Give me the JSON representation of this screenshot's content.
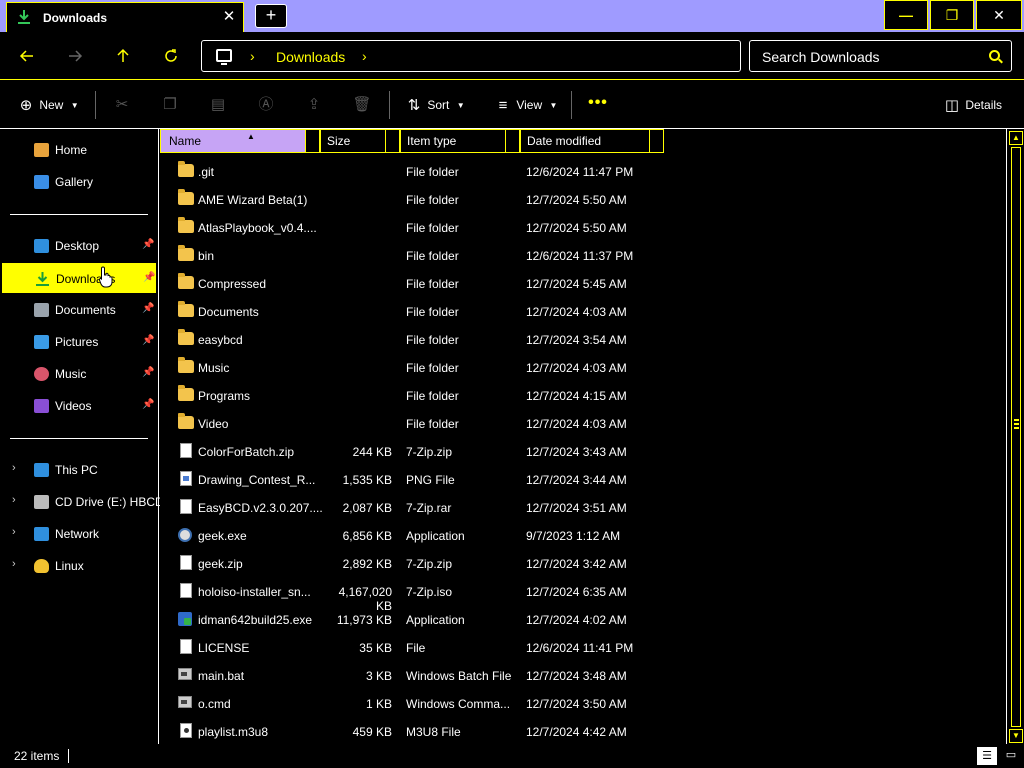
{
  "window": {
    "tab_title": "Downloads",
    "tab_close": "✕",
    "new_tab": "+",
    "minimize": "—",
    "maximize": "❐",
    "close": "✕"
  },
  "address": {
    "crumbs": [
      "Downloads"
    ],
    "search_placeholder": "Search Downloads"
  },
  "toolbar": {
    "new_label": "New",
    "sort_label": "Sort",
    "view_label": "View",
    "details_label": "Details",
    "more_label": "•••"
  },
  "sidebar": {
    "items": [
      {
        "label": "Home",
        "icon": "home-icon"
      },
      {
        "label": "Gallery",
        "icon": "gallery-icon"
      },
      {
        "label": "Desktop",
        "icon": "desktop-icon",
        "pinned": true
      },
      {
        "label": "Downloads",
        "icon": "downloads-icon",
        "pinned": true,
        "selected": true
      },
      {
        "label": "Documents",
        "icon": "documents-icon",
        "pinned": true
      },
      {
        "label": "Pictures",
        "icon": "pictures-icon",
        "pinned": true
      },
      {
        "label": "Music",
        "icon": "music-icon",
        "pinned": true
      },
      {
        "label": "Videos",
        "icon": "videos-icon",
        "pinned": true
      },
      {
        "label": "This PC",
        "icon": "this-pc-icon",
        "expandable": true
      },
      {
        "label": "CD Drive (E:) HBCD",
        "icon": "cd-drive-icon",
        "expandable": true
      },
      {
        "label": "Network",
        "icon": "network-icon",
        "expandable": true
      },
      {
        "label": "Linux",
        "icon": "linux-icon",
        "expandable": true
      }
    ]
  },
  "columns": {
    "name": "Name",
    "size": "Size",
    "type": "Item type",
    "date": "Date modified"
  },
  "files": [
    {
      "name": ".git",
      "size": "",
      "type": "File folder",
      "date": "12/6/2024 11:47 PM",
      "icon": "folder"
    },
    {
      "name": "AME Wizard Beta(1)",
      "size": "",
      "type": "File folder",
      "date": "12/7/2024 5:50 AM",
      "icon": "folder"
    },
    {
      "name": "AtlasPlaybook_v0.4....",
      "size": "",
      "type": "File folder",
      "date": "12/7/2024 5:50 AM",
      "icon": "folder"
    },
    {
      "name": "bin",
      "size": "",
      "type": "File folder",
      "date": "12/6/2024 11:37 PM",
      "icon": "folder"
    },
    {
      "name": "Compressed",
      "size": "",
      "type": "File folder",
      "date": "12/7/2024 5:45 AM",
      "icon": "folder"
    },
    {
      "name": "Documents",
      "size": "",
      "type": "File folder",
      "date": "12/7/2024 4:03 AM",
      "icon": "folder"
    },
    {
      "name": "easybcd",
      "size": "",
      "type": "File folder",
      "date": "12/7/2024 3:54 AM",
      "icon": "folder"
    },
    {
      "name": "Music",
      "size": "",
      "type": "File folder",
      "date": "12/7/2024 4:03 AM",
      "icon": "folder"
    },
    {
      "name": "Programs",
      "size": "",
      "type": "File folder",
      "date": "12/7/2024 4:15 AM",
      "icon": "folder"
    },
    {
      "name": "Video",
      "size": "",
      "type": "File folder",
      "date": "12/7/2024 4:03 AM",
      "icon": "folder"
    },
    {
      "name": "ColorForBatch.zip",
      "size": "244 KB",
      "type": "7-Zip.zip",
      "date": "12/7/2024 3:43 AM",
      "icon": "file"
    },
    {
      "name": "Drawing_Contest_R...",
      "size": "1,535 KB",
      "type": "PNG File",
      "date": "12/7/2024 3:44 AM",
      "icon": "png"
    },
    {
      "name": "EasyBCD.v2.3.0.207....",
      "size": "2,087 KB",
      "type": "7-Zip.rar",
      "date": "12/7/2024 3:51 AM",
      "icon": "file"
    },
    {
      "name": "geek.exe",
      "size": "6,856 KB",
      "type": "Application",
      "date": "9/7/2023 1:12 AM",
      "icon": "app"
    },
    {
      "name": "geek.zip",
      "size": "2,892 KB",
      "type": "7-Zip.zip",
      "date": "12/7/2024 3:42 AM",
      "icon": "file"
    },
    {
      "name": "holoiso-installer_sn...",
      "size": "4,167,020 KB",
      "type": "7-Zip.iso",
      "date": "12/7/2024 6:35 AM",
      "icon": "file"
    },
    {
      "name": "idman642build25.exe",
      "size": "11,973 KB",
      "type": "Application",
      "date": "12/7/2024 4:02 AM",
      "icon": "idm"
    },
    {
      "name": "LICENSE",
      "size": "35 KB",
      "type": "File",
      "date": "12/6/2024 11:41 PM",
      "icon": "file"
    },
    {
      "name": "main.bat",
      "size": "3 KB",
      "type": "Windows Batch File",
      "date": "12/7/2024 3:48 AM",
      "icon": "bat"
    },
    {
      "name": "o.cmd",
      "size": "1 KB",
      "type": "Windows Comma...",
      "date": "12/7/2024 3:50 AM",
      "icon": "bat"
    },
    {
      "name": "playlist.m3u8",
      "size": "459 KB",
      "type": "M3U8 File",
      "date": "12/7/2024 4:42 AM",
      "icon": "m3u"
    }
  ],
  "status": {
    "item_count": "22 items"
  },
  "colors": {
    "accent": "#ffff00",
    "titlebar": "#9f9bff",
    "selected_column": "#c6a4f5"
  }
}
